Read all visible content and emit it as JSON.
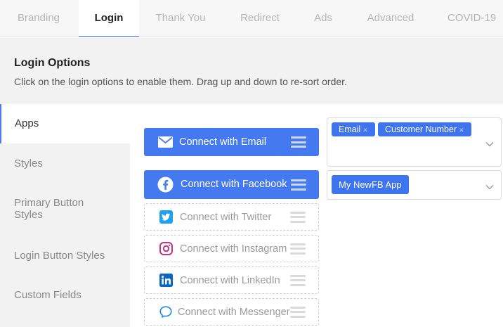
{
  "tabs": [
    {
      "label": "Branding",
      "active": false
    },
    {
      "label": "Login",
      "active": true
    },
    {
      "label": "Thank You",
      "active": false
    },
    {
      "label": "Redirect",
      "active": false
    },
    {
      "label": "Ads",
      "active": false
    },
    {
      "label": "Advanced",
      "active": false
    },
    {
      "label": "COVID-19",
      "active": false
    }
  ],
  "header": {
    "title": "Login Options",
    "description": "Click on the login options to enable them. Drag up and down to re-sort order."
  },
  "sidenav": {
    "items": [
      {
        "label": "Apps",
        "active": true
      },
      {
        "label": "Styles",
        "active": false
      },
      {
        "label": "Primary Button Styles",
        "active": false
      },
      {
        "label": "Login Button Styles",
        "active": false
      },
      {
        "label": "Custom Fields",
        "active": false
      }
    ]
  },
  "login_options": [
    {
      "label": "Connect with Email",
      "enabled": true,
      "icon": "envelope-icon"
    },
    {
      "label": "Connect with Facebook",
      "enabled": true,
      "icon": "facebook-icon"
    },
    {
      "label": "Connect with Twitter",
      "enabled": false,
      "icon": "twitter-icon"
    },
    {
      "label": "Connect with Instagram",
      "enabled": false,
      "icon": "instagram-icon"
    },
    {
      "label": "Connect with LinkedIn",
      "enabled": false,
      "icon": "linkedin-icon"
    },
    {
      "label": "Connect with Messenger",
      "enabled": false,
      "icon": "messenger-icon"
    }
  ],
  "email_select": {
    "tags": [
      "Email",
      "Customer Number"
    ],
    "remove_glyph": "✕"
  },
  "facebook_select": {
    "tags": [
      "My NewFB App"
    ]
  },
  "colors": {
    "accent": "#4479f0",
    "tag": "#3f74ef",
    "twitter": "#1da1f2",
    "instagram": "#c13584",
    "linkedin": "#0a66c2",
    "messenger": "#1e88e5"
  }
}
